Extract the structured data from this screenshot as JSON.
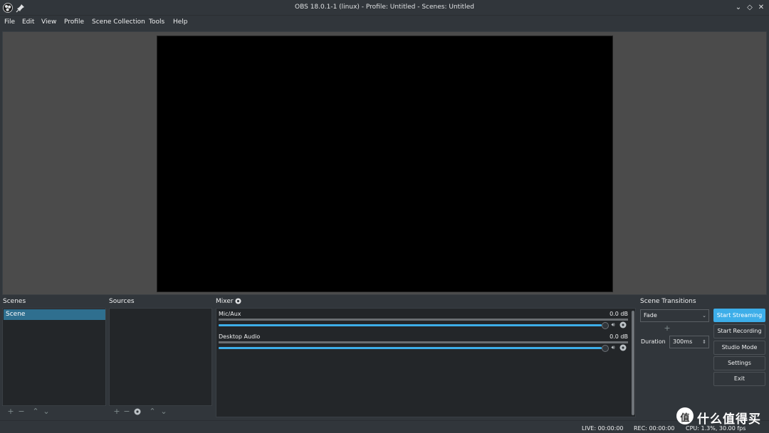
{
  "window": {
    "title": "OBS 18.0.1-1 (linux) - Profile: Untitled - Scenes: Untitled",
    "controls": [
      "minimize",
      "maximize",
      "close"
    ]
  },
  "menu": {
    "items": [
      "File",
      "Edit",
      "View",
      "Profile",
      "Scene Collection",
      "Tools",
      "Help"
    ]
  },
  "docks": {
    "scenes_label": "Scenes",
    "sources_label": "Sources",
    "mixer_label": "Mixer",
    "transitions_label": "Scene Transitions"
  },
  "scenes": {
    "items": [
      "Scene"
    ],
    "selected": "Scene"
  },
  "mixer": {
    "channels": [
      {
        "name": "Mic/Aux",
        "level": "0.0 dB"
      },
      {
        "name": "Desktop Audio",
        "level": "0.0 dB"
      }
    ]
  },
  "transitions": {
    "selected": "Fade",
    "duration_label": "Duration",
    "duration_value": "300ms"
  },
  "controls": {
    "start_streaming": "Start Streaming",
    "start_recording": "Start Recording",
    "studio_mode": "Studio Mode",
    "settings": "Settings",
    "exit": "Exit"
  },
  "status": {
    "live": "LIVE: 00:00:00",
    "rec": "REC: 00:00:00",
    "cpu": "CPU: 1.3%, 30.00 fps"
  },
  "watermark": {
    "logo_char": "值",
    "text": "什么值得买"
  },
  "colors": {
    "accent": "#3daee9",
    "background": "#31363b",
    "panel": "#232629",
    "preview_background": "#4b4b4b",
    "canvas": "#000000"
  }
}
